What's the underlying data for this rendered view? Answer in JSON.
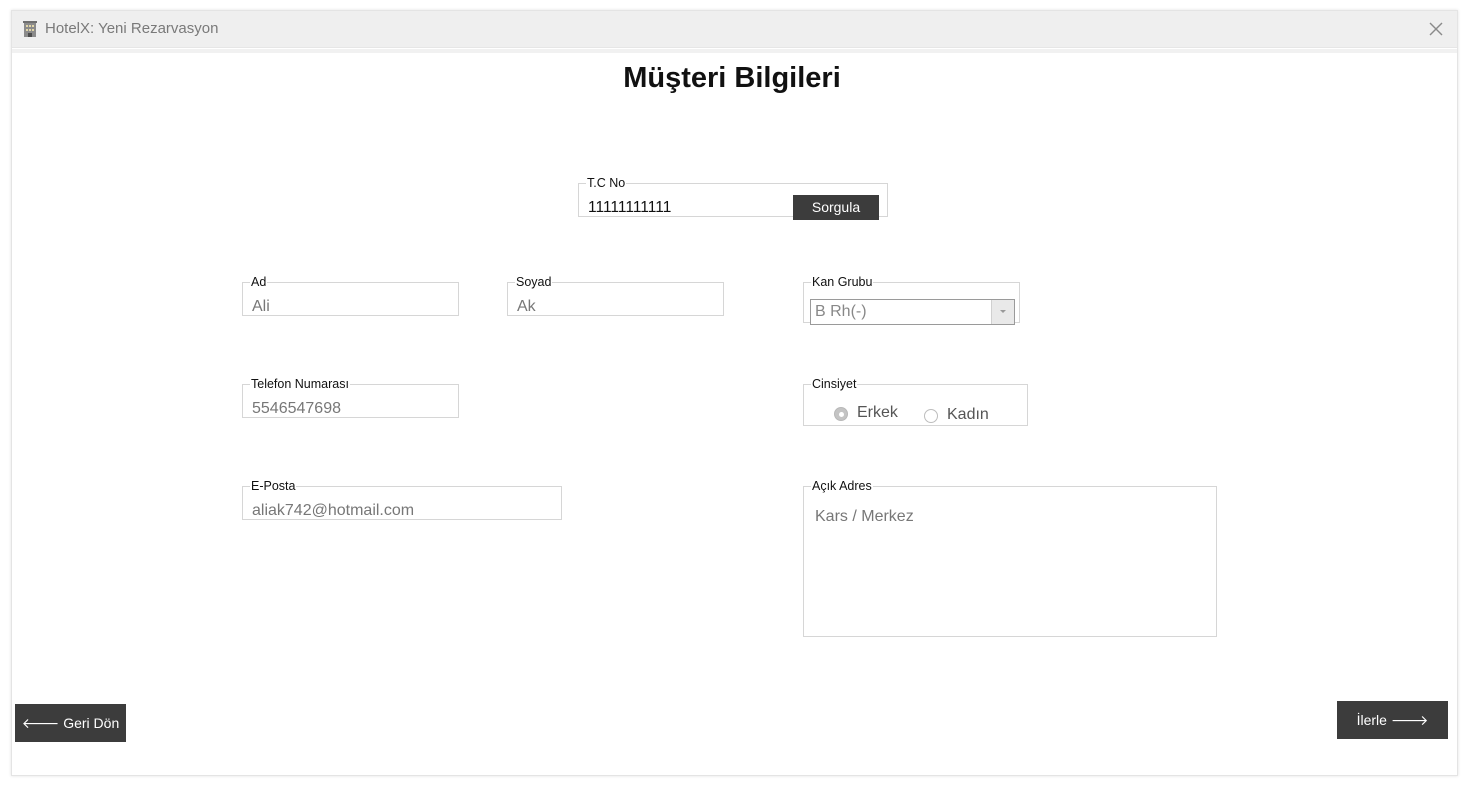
{
  "window": {
    "title": "HotelX: Yeni Rezarvasyon"
  },
  "page": {
    "title": "Müşteri Bilgileri"
  },
  "tc": {
    "label": "T.C No",
    "value": "11111111111",
    "button_label": "Sorgula"
  },
  "ad": {
    "label": "Ad",
    "value": "Ali"
  },
  "soyad": {
    "label": "Soyad",
    "value": "Ak"
  },
  "kan_grubu": {
    "label": "Kan Grubu",
    "selected": "B Rh(-)"
  },
  "telefon": {
    "label": "Telefon Numarası",
    "value": "5546547698"
  },
  "cinsiyet": {
    "label": "Cinsiyet",
    "options": [
      {
        "label": "Erkek",
        "checked": true
      },
      {
        "label": "Kadın",
        "checked": false
      }
    ]
  },
  "eposta": {
    "label": "E-Posta",
    "value": "aliak742@hotmail.com"
  },
  "adres": {
    "label": "Açık Adres",
    "value": "Kars / Merkez"
  },
  "nav": {
    "back_label": "Geri Dön",
    "next_label": "İlerle"
  },
  "colors": {
    "button_dark": "#3c3c3c",
    "title_bar": "#efefef",
    "field_border": "#d6d6d6"
  },
  "icons": [
    "hotel-icon",
    "close-icon",
    "arrow-left-icon",
    "arrow-right-icon",
    "chevron-down-icon"
  ]
}
